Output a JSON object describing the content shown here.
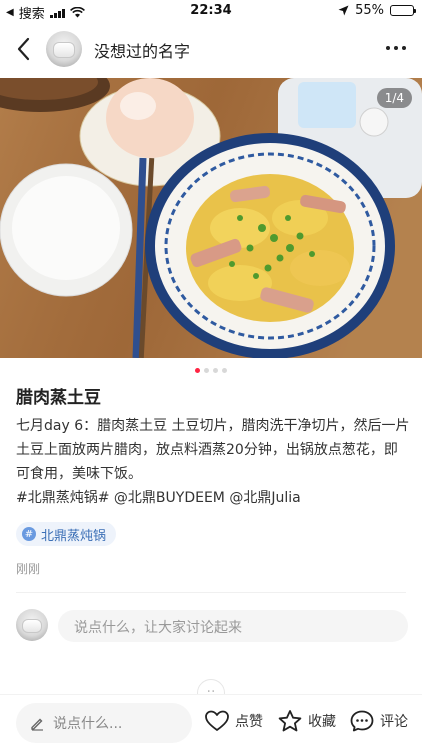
{
  "status_bar": {
    "carrier": "搜索",
    "time": "22:34",
    "battery_text": "55%",
    "battery_level": 0.55
  },
  "header": {
    "author_name": "没想过的名字"
  },
  "image": {
    "pager": "1/4",
    "current_page": 1,
    "total_pages": 4
  },
  "post": {
    "title": "腊肉蒸土豆",
    "body": "七月day 6：腊肉蒸土豆  土豆切片，腊肉洗干净切片，然后一片土豆上面放两片腊肉，放点料酒蒸20分钟，出锅放点葱花，即可食用，美味下饭。",
    "tags_line": "#北鼎蒸炖锅# @北鼎BUYDEEM @北鼎Julia",
    "topic_chip": "北鼎蒸炖锅",
    "posted_time": "刚刚"
  },
  "comments": {
    "input_placeholder": "说点什么，让大家讨论起来"
  },
  "bottom_bar": {
    "input_placeholder": "说点什么...",
    "like_label": "点赞",
    "collect_label": "收藏",
    "comment_label": "评论"
  },
  "colors": {
    "accent": "#ff2442",
    "topic_blue": "#3b6fb6",
    "wood": "#a9713f"
  },
  "icons": [
    "back-arrow-icon",
    "more-icon",
    "location-arrow-icon",
    "wifi-icon",
    "hash-icon",
    "pencil-icon",
    "heart-icon",
    "star-icon",
    "comment-bubble-icon"
  ]
}
